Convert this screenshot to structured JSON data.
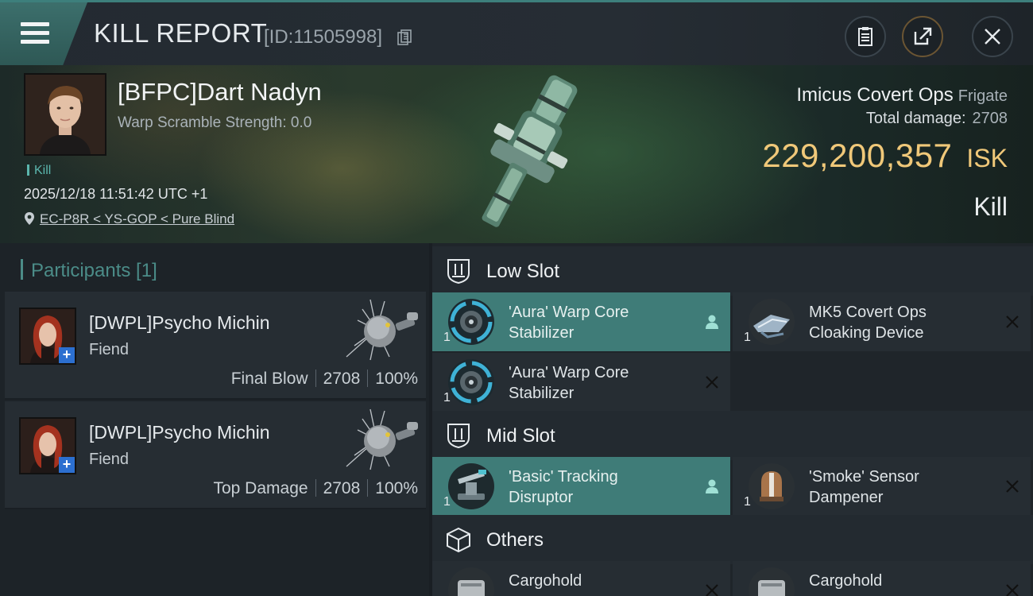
{
  "header": {
    "title": "KILL REPORT",
    "report_id": "[ID:11505998]"
  },
  "victim": {
    "name": "[BFPC]Dart Nadyn",
    "warp_scramble": "Warp Scramble Strength: 0.0",
    "tag": "Kill",
    "timestamp": "2025/12/18 11:51:42 UTC +1",
    "location": "EC-P8R < YS-GOP < Pure Blind",
    "ship_name": "Imicus Covert Ops",
    "ship_class": "Frigate",
    "total_damage_label": "Total damage:",
    "total_damage": "2708",
    "isk_value": "229,200,357",
    "isk_unit": "ISK",
    "result": "Kill"
  },
  "participants": {
    "header": "Participants [1]",
    "rows": [
      {
        "name": "[DWPL]Psycho Michin",
        "ship": "Fiend",
        "label": "Final Blow",
        "damage": "2708",
        "percent": "100%"
      },
      {
        "name": "[DWPL]Psycho Michin",
        "ship": "Fiend",
        "label": "Top Damage",
        "damage": "2708",
        "percent": "100%"
      }
    ]
  },
  "fitting": {
    "low_slot": {
      "title": "Low Slot",
      "modules": [
        {
          "name": "'Aura' Warp Core Stabilizer",
          "qty": "1",
          "status": "dropped",
          "icon": "warp-core-stabilizer-icon"
        },
        {
          "name": "MK5 Covert Ops Cloaking Device",
          "qty": "1",
          "status": "destroyed",
          "icon": "cloaking-device-icon"
        },
        {
          "name": "'Aura' Warp Core Stabilizer",
          "qty": "1",
          "status": "destroyed",
          "icon": "warp-core-stabilizer-icon"
        }
      ]
    },
    "mid_slot": {
      "title": "Mid Slot",
      "modules": [
        {
          "name": "'Basic' Tracking Disruptor",
          "qty": "1",
          "status": "dropped",
          "icon": "tracking-disruptor-icon"
        },
        {
          "name": "'Smoke' Sensor Dampener",
          "qty": "1",
          "status": "destroyed",
          "icon": "sensor-dampener-icon"
        }
      ]
    },
    "others": {
      "title": "Others",
      "modules": [
        {
          "name": "Cargohold",
          "qty": "",
          "status": "destroyed",
          "icon": "cargohold-icon"
        },
        {
          "name": "Cargohold",
          "qty": "",
          "status": "destroyed",
          "icon": "cargohold-icon"
        }
      ]
    }
  },
  "colors": {
    "accent_teal": "#3f7c78",
    "isk_gold": "#f0c879",
    "participants_header": "#4b8c88"
  }
}
